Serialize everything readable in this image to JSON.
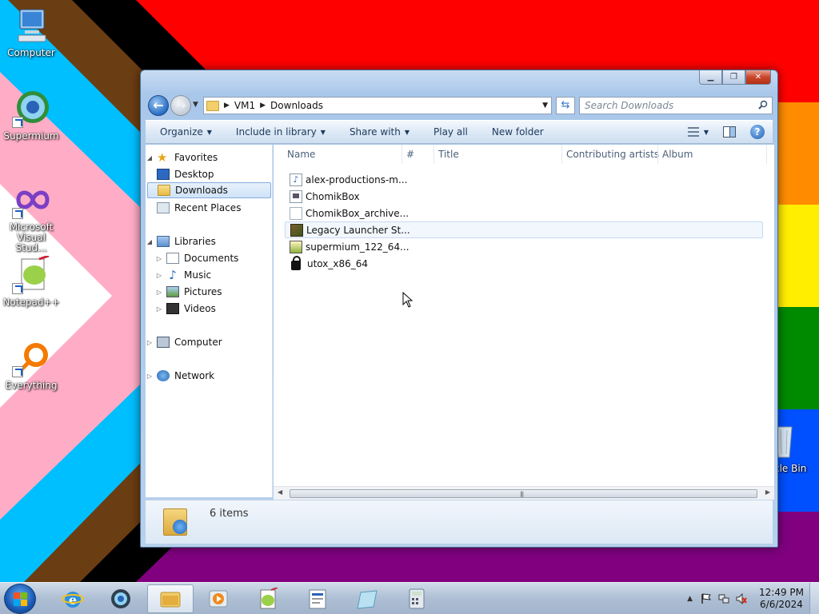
{
  "desktop": {
    "icons": [
      {
        "label": "Computer",
        "icon": "computer-icon"
      },
      {
        "label": "Supermium",
        "icon": "supermium-icon"
      },
      {
        "label": "Microsoft Visual Stud...",
        "icon": "visual-studio-icon"
      },
      {
        "label": "Notepad++",
        "icon": "notepadpp-icon"
      },
      {
        "label": "Everything",
        "icon": "everything-icon"
      },
      {
        "label": "cle Bin",
        "icon": "recycle-bin-icon"
      }
    ]
  },
  "window": {
    "nav": {
      "crumbs": [
        "VM1",
        "Downloads"
      ],
      "search_placeholder": "Search Downloads"
    },
    "toolbar": {
      "organize": "Organize",
      "include_in_library": "Include in library",
      "share_with": "Share with",
      "play_all": "Play all",
      "new_folder": "New folder"
    },
    "navpane": {
      "favorites": "Favorites",
      "desktop": "Desktop",
      "downloads": "Downloads",
      "recent_places": "Recent Places",
      "libraries": "Libraries",
      "documents": "Documents",
      "music": "Music",
      "pictures": "Pictures",
      "videos": "Videos",
      "computer": "Computer",
      "network": "Network"
    },
    "columns": {
      "name": "Name",
      "number": "#",
      "title": "Title",
      "contributing_artists": "Contributing artists",
      "album": "Album"
    },
    "files": [
      {
        "name": "alex-productions-m...",
        "icon": "audio-file-icon"
      },
      {
        "name": "ChomikBox",
        "icon": "application-icon"
      },
      {
        "name": "ChomikBox_archive...",
        "icon": "blank-file-icon"
      },
      {
        "name": "Legacy Launcher St...",
        "icon": "minecraft-launcher-icon"
      },
      {
        "name": "supermium_122_64...",
        "icon": "installer-icon"
      },
      {
        "name": "utox_x86_64",
        "icon": "lock-icon"
      }
    ],
    "details": {
      "count": "6 items"
    }
  },
  "taskbar": {
    "clock_time": "12:49 PM",
    "clock_date": "6/6/2024"
  },
  "colors": {
    "wallpaper_red": "#ff0000",
    "wallpaper_orange": "#ff8c00",
    "wallpaper_yellow": "#ffee00",
    "wallpaper_green": "#008a00",
    "wallpaper_blue": "#0050ff",
    "wallpaper_purple": "#800080",
    "cyan": "#00bfff",
    "pink": "#ffadc7",
    "brown": "#6b3d12",
    "accent": "#3573c4"
  }
}
